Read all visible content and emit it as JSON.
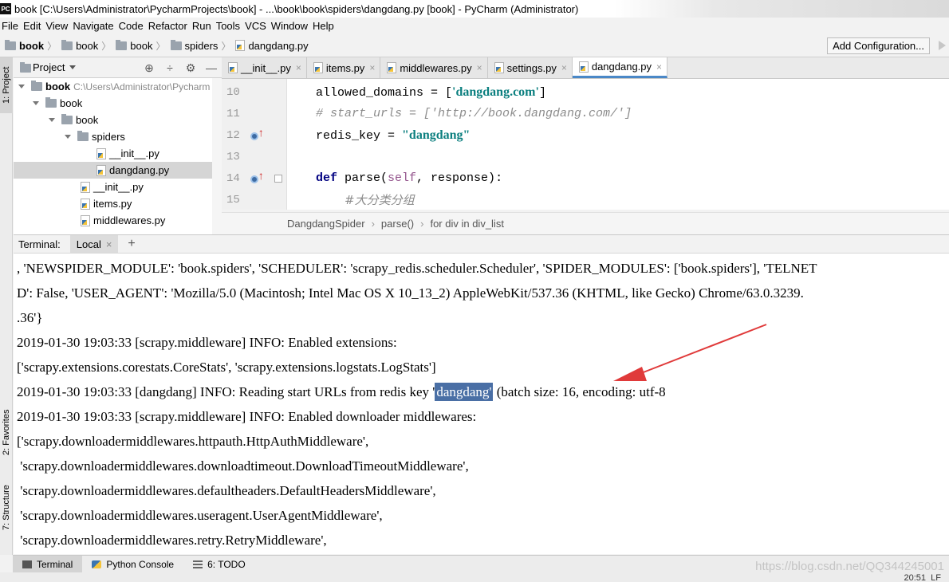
{
  "window": {
    "title": "book [C:\\Users\\Administrator\\PycharmProjects\\book] - ...\\book\\book\\spiders\\dangdang.py [book] - PyCharm (Administrator)",
    "app_icon": "PC"
  },
  "menu": [
    "File",
    "Edit",
    "View",
    "Navigate",
    "Code",
    "Refactor",
    "Run",
    "Tools",
    "VCS",
    "Window",
    "Help"
  ],
  "breadcrumb": {
    "items": [
      "book",
      "book",
      "book",
      "spiders",
      "dangdang.py"
    ]
  },
  "toolbar": {
    "add_config_label": "Add Configuration..."
  },
  "left_strip": {
    "project_tab": "1: Project",
    "favorites_tab": "2: Favorites",
    "structure_tab": "7: Structure"
  },
  "project_panel": {
    "header_label": "Project",
    "tree": [
      {
        "label": "book",
        "path": "C:\\Users\\Administrator\\Pycharm",
        "kind": "folder",
        "depth": 0,
        "expanded": true,
        "bold": true
      },
      {
        "label": "book",
        "kind": "folder",
        "depth": 1,
        "expanded": true
      },
      {
        "label": "book",
        "kind": "folder",
        "depth": 2,
        "expanded": true
      },
      {
        "label": "spiders",
        "kind": "folder",
        "depth": 3,
        "expanded": true
      },
      {
        "label": "__init__.py",
        "kind": "py",
        "depth": 4
      },
      {
        "label": "dangdang.py",
        "kind": "py",
        "depth": 4,
        "selected": true
      },
      {
        "label": "__init__.py",
        "kind": "py",
        "depth": 3
      },
      {
        "label": "items.py",
        "kind": "py",
        "depth": 3
      },
      {
        "label": "middlewares.py",
        "kind": "py",
        "depth": 3
      }
    ]
  },
  "editor_tabs": [
    {
      "label": "__init__.py",
      "active": false
    },
    {
      "label": "items.py",
      "active": false
    },
    {
      "label": "middlewares.py",
      "active": false
    },
    {
      "label": "settings.py",
      "active": false
    },
    {
      "label": "dangdang.py",
      "active": true
    }
  ],
  "editor": {
    "line_numbers": [
      "10",
      "11",
      "12",
      "13",
      "14",
      "15"
    ],
    "lines": [
      {
        "a": "allowed_domains = [",
        "b": "'dangdang.com'",
        "c": "]"
      },
      {
        "comment": "# start_urls = ['http://book.dangdang.com/']"
      },
      {
        "a": "redis_key = ",
        "b": "\"dangdang\""
      },
      {},
      {
        "kw": "def ",
        "fn": "parse(",
        "slf": "self",
        "rest": ", response):"
      },
      {
        "comment": "#大分类分组"
      }
    ],
    "code_breadcrumb": [
      "DangdangSpider",
      "parse()",
      "for div in div_list"
    ]
  },
  "terminal": {
    "header_label": "Terminal:",
    "tab_label": "Local",
    "lines": [
      ", 'NEWSPIDER_MODULE': 'book.spiders', 'SCHEDULER': 'scrapy_redis.scheduler.Scheduler', 'SPIDER_MODULES': ['book.spiders'], 'TELNET",
      "D': False, 'USER_AGENT': 'Mozilla/5.0 (Macintosh; Intel Mac OS X 10_13_2) AppleWebKit/537.36 (KHTML, like Gecko) Chrome/63.0.3239.",
      ".36'}",
      "2019-01-30 19:03:33 [scrapy.middleware] INFO: Enabled extensions:",
      "['scrapy.extensions.corestats.CoreStats', 'scrapy.extensions.logstats.LogStats']",
      {
        "pre": "2019-01-30 19:03:33 [dangdang] INFO: Reading start URLs from redis key '",
        "hl": "dangdang'",
        "post": " (batch size: 16, encoding: utf-8"
      },
      "2019-01-30 19:03:33 [scrapy.middleware] INFO: Enabled downloader middlewares:",
      "['scrapy.downloadermiddlewares.httpauth.HttpAuthMiddleware',",
      " 'scrapy.downloadermiddlewares.downloadtimeout.DownloadTimeoutMiddleware',",
      " 'scrapy.downloadermiddlewares.defaultheaders.DefaultHeadersMiddleware',",
      " 'scrapy.downloadermiddlewares.useragent.UserAgentMiddleware',",
      " 'scrapy.downloadermiddlewares.retry.RetryMiddleware',"
    ],
    "highlight_color": "#4a6fa5"
  },
  "bottom_tabs": [
    {
      "label": "Terminal",
      "active": true,
      "icon": "terminal-icon"
    },
    {
      "label": "Python Console",
      "active": false,
      "icon": "python-console-icon"
    },
    {
      "label": "6: TODO",
      "active": false,
      "icon": "todo-icon"
    }
  ],
  "watermark": "https://blog.csdn.net/QQ344245001",
  "status": {
    "position": "20:51",
    "line_sep": "LF"
  },
  "colors": {
    "accent": "#4a88c7",
    "string": "#0b7f7f",
    "keyword": "#000080",
    "arrow": "#e03a3a"
  }
}
